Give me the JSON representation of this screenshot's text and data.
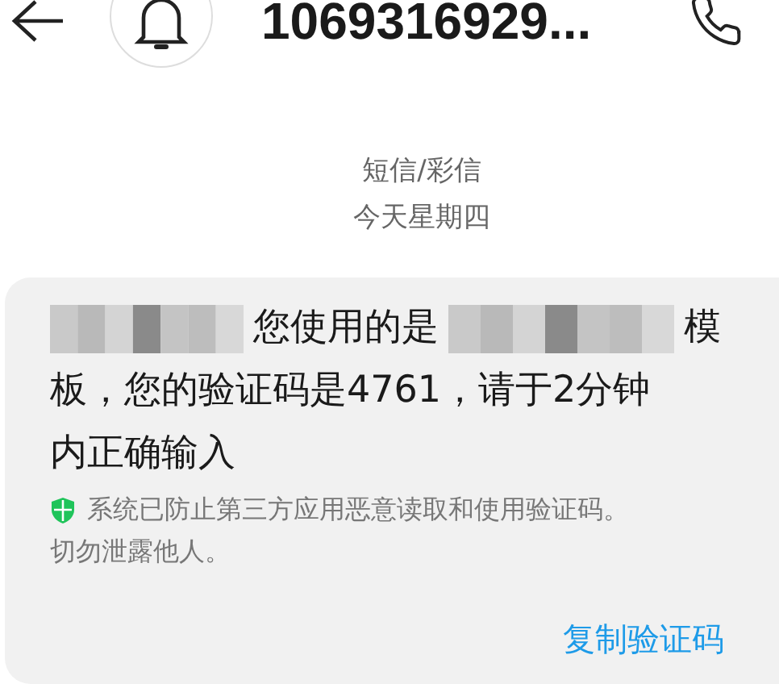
{
  "header": {
    "title": "1069316929..."
  },
  "conversation": {
    "channel": "短信/彩信",
    "date": "今天星期四"
  },
  "message": {
    "lines": [
      [
        {
          "kind": "redacted"
        },
        {
          "kind": "text",
          "text": "您使用的是"
        },
        {
          "kind": "redacted"
        },
        {
          "kind": "text",
          "text": "模"
        }
      ],
      [
        {
          "kind": "text",
          "text": "板，您的验证码是4761，请于2分钟"
        }
      ],
      [
        {
          "kind": "text",
          "text": "内正确输入"
        }
      ]
    ],
    "notice_lines": [
      "系统已防止第三方应用恶意读取和使用验证码。",
      "切勿泄露他人。"
    ],
    "action": "复制验证码"
  }
}
